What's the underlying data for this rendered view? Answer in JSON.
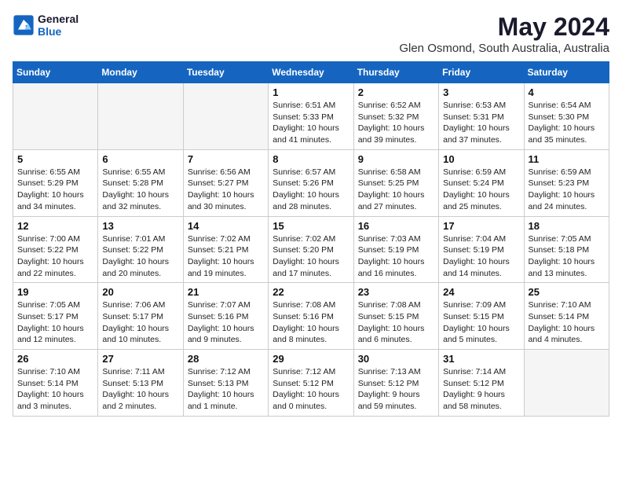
{
  "header": {
    "logo_line1": "General",
    "logo_line2": "Blue",
    "month_title": "May 2024",
    "location": "Glen Osmond, South Australia, Australia"
  },
  "days_of_week": [
    "Sunday",
    "Monday",
    "Tuesday",
    "Wednesday",
    "Thursday",
    "Friday",
    "Saturday"
  ],
  "weeks": [
    [
      {
        "day": "",
        "info": ""
      },
      {
        "day": "",
        "info": ""
      },
      {
        "day": "",
        "info": ""
      },
      {
        "day": "1",
        "info": "Sunrise: 6:51 AM\nSunset: 5:33 PM\nDaylight: 10 hours\nand 41 minutes."
      },
      {
        "day": "2",
        "info": "Sunrise: 6:52 AM\nSunset: 5:32 PM\nDaylight: 10 hours\nand 39 minutes."
      },
      {
        "day": "3",
        "info": "Sunrise: 6:53 AM\nSunset: 5:31 PM\nDaylight: 10 hours\nand 37 minutes."
      },
      {
        "day": "4",
        "info": "Sunrise: 6:54 AM\nSunset: 5:30 PM\nDaylight: 10 hours\nand 35 minutes."
      }
    ],
    [
      {
        "day": "5",
        "info": "Sunrise: 6:55 AM\nSunset: 5:29 PM\nDaylight: 10 hours\nand 34 minutes."
      },
      {
        "day": "6",
        "info": "Sunrise: 6:55 AM\nSunset: 5:28 PM\nDaylight: 10 hours\nand 32 minutes."
      },
      {
        "day": "7",
        "info": "Sunrise: 6:56 AM\nSunset: 5:27 PM\nDaylight: 10 hours\nand 30 minutes."
      },
      {
        "day": "8",
        "info": "Sunrise: 6:57 AM\nSunset: 5:26 PM\nDaylight: 10 hours\nand 28 minutes."
      },
      {
        "day": "9",
        "info": "Sunrise: 6:58 AM\nSunset: 5:25 PM\nDaylight: 10 hours\nand 27 minutes."
      },
      {
        "day": "10",
        "info": "Sunrise: 6:59 AM\nSunset: 5:24 PM\nDaylight: 10 hours\nand 25 minutes."
      },
      {
        "day": "11",
        "info": "Sunrise: 6:59 AM\nSunset: 5:23 PM\nDaylight: 10 hours\nand 24 minutes."
      }
    ],
    [
      {
        "day": "12",
        "info": "Sunrise: 7:00 AM\nSunset: 5:22 PM\nDaylight: 10 hours\nand 22 minutes."
      },
      {
        "day": "13",
        "info": "Sunrise: 7:01 AM\nSunset: 5:22 PM\nDaylight: 10 hours\nand 20 minutes."
      },
      {
        "day": "14",
        "info": "Sunrise: 7:02 AM\nSunset: 5:21 PM\nDaylight: 10 hours\nand 19 minutes."
      },
      {
        "day": "15",
        "info": "Sunrise: 7:02 AM\nSunset: 5:20 PM\nDaylight: 10 hours\nand 17 minutes."
      },
      {
        "day": "16",
        "info": "Sunrise: 7:03 AM\nSunset: 5:19 PM\nDaylight: 10 hours\nand 16 minutes."
      },
      {
        "day": "17",
        "info": "Sunrise: 7:04 AM\nSunset: 5:19 PM\nDaylight: 10 hours\nand 14 minutes."
      },
      {
        "day": "18",
        "info": "Sunrise: 7:05 AM\nSunset: 5:18 PM\nDaylight: 10 hours\nand 13 minutes."
      }
    ],
    [
      {
        "day": "19",
        "info": "Sunrise: 7:05 AM\nSunset: 5:17 PM\nDaylight: 10 hours\nand 12 minutes."
      },
      {
        "day": "20",
        "info": "Sunrise: 7:06 AM\nSunset: 5:17 PM\nDaylight: 10 hours\nand 10 minutes."
      },
      {
        "day": "21",
        "info": "Sunrise: 7:07 AM\nSunset: 5:16 PM\nDaylight: 10 hours\nand 9 minutes."
      },
      {
        "day": "22",
        "info": "Sunrise: 7:08 AM\nSunset: 5:16 PM\nDaylight: 10 hours\nand 8 minutes."
      },
      {
        "day": "23",
        "info": "Sunrise: 7:08 AM\nSunset: 5:15 PM\nDaylight: 10 hours\nand 6 minutes."
      },
      {
        "day": "24",
        "info": "Sunrise: 7:09 AM\nSunset: 5:15 PM\nDaylight: 10 hours\nand 5 minutes."
      },
      {
        "day": "25",
        "info": "Sunrise: 7:10 AM\nSunset: 5:14 PM\nDaylight: 10 hours\nand 4 minutes."
      }
    ],
    [
      {
        "day": "26",
        "info": "Sunrise: 7:10 AM\nSunset: 5:14 PM\nDaylight: 10 hours\nand 3 minutes."
      },
      {
        "day": "27",
        "info": "Sunrise: 7:11 AM\nSunset: 5:13 PM\nDaylight: 10 hours\nand 2 minutes."
      },
      {
        "day": "28",
        "info": "Sunrise: 7:12 AM\nSunset: 5:13 PM\nDaylight: 10 hours\nand 1 minute."
      },
      {
        "day": "29",
        "info": "Sunrise: 7:12 AM\nSunset: 5:12 PM\nDaylight: 10 hours\nand 0 minutes."
      },
      {
        "day": "30",
        "info": "Sunrise: 7:13 AM\nSunset: 5:12 PM\nDaylight: 9 hours\nand 59 minutes."
      },
      {
        "day": "31",
        "info": "Sunrise: 7:14 AM\nSunset: 5:12 PM\nDaylight: 9 hours\nand 58 minutes."
      },
      {
        "day": "",
        "info": ""
      }
    ]
  ]
}
